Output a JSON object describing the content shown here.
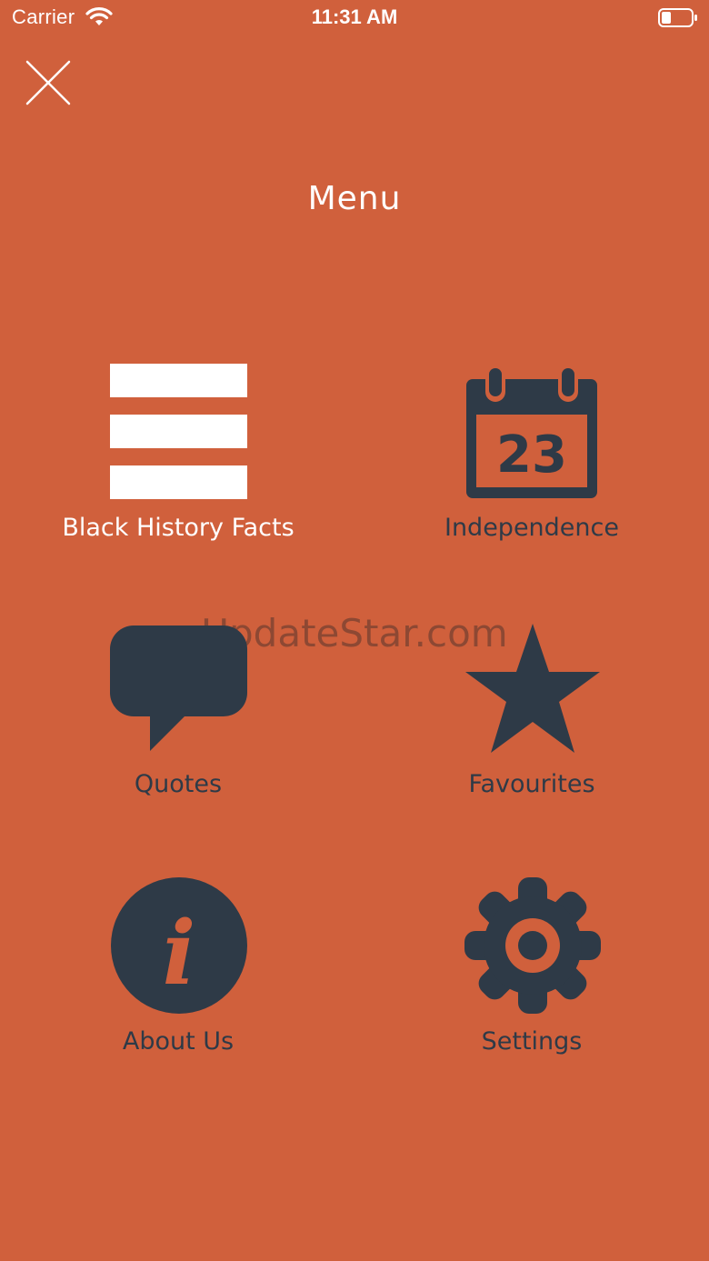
{
  "status_bar": {
    "carrier": "Carrier",
    "time": "11:31 AM"
  },
  "header": {
    "title": "Menu"
  },
  "menu": {
    "items": [
      {
        "label": "Black History Facts",
        "icon": "list-icon"
      },
      {
        "label": "Independence",
        "icon": "calendar-icon",
        "calendar_day": "23"
      },
      {
        "label": "Quotes",
        "icon": "speech-bubble-icon"
      },
      {
        "label": "Favourites",
        "icon": "star-icon"
      },
      {
        "label": "About Us",
        "icon": "info-icon"
      },
      {
        "label": "Settings",
        "icon": "gear-icon"
      }
    ]
  },
  "watermark": "UpdateStar.com",
  "colors": {
    "background": "#D0603C",
    "icon_dark": "#2E3A47",
    "active": "#FFFFFF"
  }
}
